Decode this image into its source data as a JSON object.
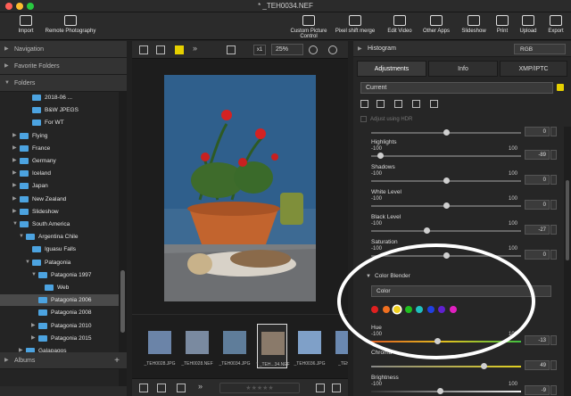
{
  "title": "* _TEH0034.NEF",
  "toolbar": {
    "left": [
      {
        "label": "Import",
        "icon": "import-icon"
      },
      {
        "label": "Remote Photography",
        "icon": "camera-icon"
      }
    ],
    "right": [
      {
        "label": "Custom Picture Control",
        "icon": "picture-control-icon"
      },
      {
        "label": "Pixel shift merge",
        "icon": "pixel-icon"
      },
      {
        "label": "Edit Video",
        "icon": "video-icon"
      },
      {
        "label": "Other Apps",
        "icon": "apps-icon"
      },
      {
        "label": "Slideshow",
        "icon": "slideshow-icon"
      },
      {
        "label": "Print",
        "icon": "print-icon"
      },
      {
        "label": "Upload",
        "icon": "upload-icon"
      },
      {
        "label": "Export",
        "icon": "export-icon"
      }
    ]
  },
  "left": {
    "navigation": "Navigation",
    "favorites": "Favorite Folders",
    "folders": "Folders",
    "albums": "Albums",
    "tree": [
      {
        "label": "2018-06 ...",
        "level": 4,
        "arrow": ""
      },
      {
        "label": "B&W JPEGS",
        "level": 4,
        "arrow": ""
      },
      {
        "label": "For WT",
        "level": 4,
        "arrow": ""
      },
      {
        "label": "Flying",
        "level": 2,
        "arrow": "▶"
      },
      {
        "label": "France",
        "level": 2,
        "arrow": "▶"
      },
      {
        "label": "Germany",
        "level": 2,
        "arrow": "▶"
      },
      {
        "label": "Iceland",
        "level": 2,
        "arrow": "▶"
      },
      {
        "label": "Japan",
        "level": 2,
        "arrow": "▶"
      },
      {
        "label": "New Zealand",
        "level": 2,
        "arrow": "▶"
      },
      {
        "label": "Slideshow",
        "level": 2,
        "arrow": "▶"
      },
      {
        "label": "South America",
        "level": 2,
        "arrow": "▼"
      },
      {
        "label": "Argentina Chile",
        "level": 3,
        "arrow": "▼"
      },
      {
        "label": "Iguasu Falls",
        "level": 4,
        "arrow": ""
      },
      {
        "label": "Patagonia",
        "level": 4,
        "arrow": "▼"
      },
      {
        "label": "Patagonia 1997",
        "level": 5,
        "arrow": "▼"
      },
      {
        "label": "Web",
        "level": 6,
        "arrow": ""
      },
      {
        "label": "Patagonia 2006",
        "level": 5,
        "arrow": ""
      },
      {
        "label": "Patagonia 2008",
        "level": 5,
        "arrow": ""
      },
      {
        "label": "Patagonia 2010",
        "level": 5,
        "arrow": "▶"
      },
      {
        "label": "Patagonia 2015",
        "level": 5,
        "arrow": "▶"
      },
      {
        "label": "Galapagos",
        "level": 3,
        "arrow": "▶"
      },
      {
        "label": "Peru",
        "level": 3,
        "arrow": "▶"
      }
    ],
    "selected_index": 16
  },
  "center": {
    "zoom": "25%",
    "zoom_factor": "x1",
    "thumbnails": [
      "_TEH0028.JPG",
      "_TEH0028.NEF",
      "_TEH0034.JPG",
      "* _TEH...34.NEF",
      "_TEH0036.JPG",
      "_TEH0..."
    ],
    "current_index": 3,
    "rating_stars": "★★★★★"
  },
  "right": {
    "histogram": "Histogram",
    "histogram_mode": "RGB",
    "tabs": [
      "Adjustments",
      "Info",
      "XMP/IPTC"
    ],
    "active_tab": 0,
    "preset": "Current",
    "adjust_hdr": "Adjust using HDR",
    "sliders": [
      {
        "name": "",
        "min": "",
        "max": "",
        "value": "0",
        "pos": 0.5
      },
      {
        "name": "Highlights",
        "min": "-100",
        "max": "100",
        "value": "-89",
        "pos": 0.06
      },
      {
        "name": "Shadows",
        "min": "-100",
        "max": "100",
        "value": "0",
        "pos": 0.5
      },
      {
        "name": "White Level",
        "min": "-100",
        "max": "100",
        "value": "0",
        "pos": 0.5
      },
      {
        "name": "Black Level",
        "min": "-100",
        "max": "100",
        "value": "-27",
        "pos": 0.37
      },
      {
        "name": "Saturation",
        "min": "-100",
        "max": "100",
        "value": "0",
        "pos": 0.5
      }
    ],
    "color_blender": "Color Blender",
    "color_mode": "Color",
    "swatches": [
      "#e02020",
      "#f07020",
      "#f0d020",
      "#20c020",
      "#20c0c0",
      "#2040e0",
      "#6020d0",
      "#e020c0"
    ],
    "hue": {
      "name": "Hue",
      "min": "-100",
      "max": "100",
      "value": "-13",
      "pos": 0.44
    },
    "chroma": {
      "name": "Chroma",
      "min": "",
      "max": "",
      "value": "49",
      "pos": 0.75
    },
    "brightness": {
      "name": "Brightness",
      "min": "-100",
      "max": "100",
      "value": "-9",
      "pos": 0.46
    }
  }
}
